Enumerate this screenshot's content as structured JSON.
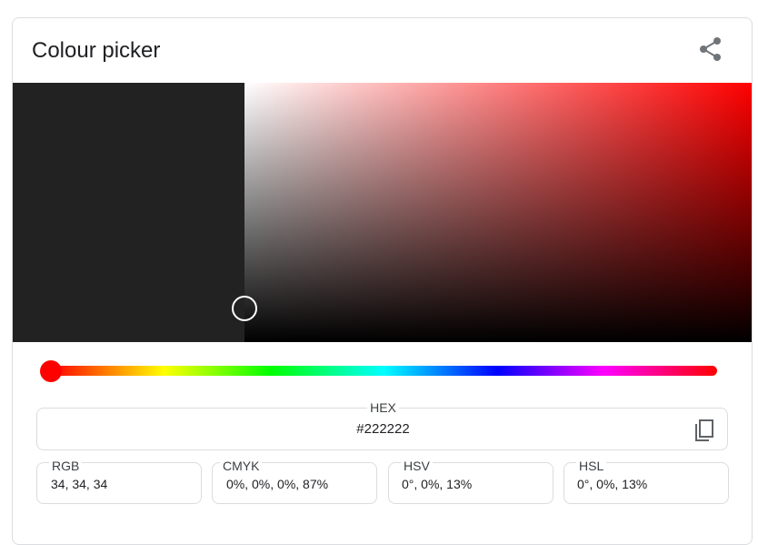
{
  "card": {
    "title": "Colour picker",
    "share_icon": "share-icon"
  },
  "picker": {
    "hue_deg": 0,
    "hue_color": "#ff0000",
    "saturation": 0,
    "value": 0.13,
    "preview_color": "#222222",
    "handle_color": "#ffffff"
  },
  "hex": {
    "label": "HEX",
    "value": "#222222",
    "copy_icon": "copy-icon"
  },
  "fields": [
    {
      "label": "RGB",
      "value": "34, 34, 34"
    },
    {
      "label": "CMYK",
      "value": "0%, 0%, 0%, 87%"
    },
    {
      "label": "HSV",
      "value": "0°, 0%, 13%"
    },
    {
      "label": "HSL",
      "value": "0°, 0%, 13%"
    }
  ]
}
